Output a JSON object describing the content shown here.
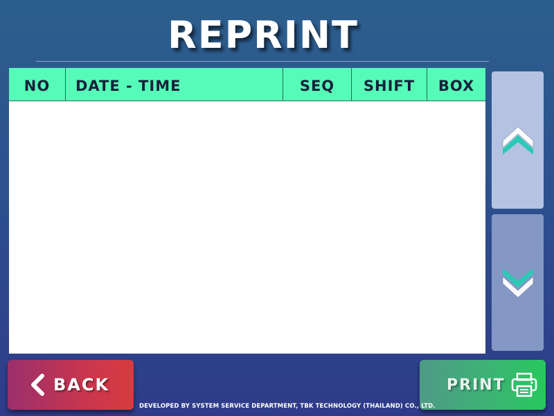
{
  "title": "REPRINT",
  "table": {
    "columns": [
      "NO",
      "DATE - TIME",
      "SEQ",
      "SHIFT",
      "BOX"
    ],
    "rows": []
  },
  "scroll": {
    "up_icon": "double-chevron-up-icon",
    "down_icon": "double-chevron-down-icon"
  },
  "buttons": {
    "back_label": "BACK",
    "back_icon": "chevron-left-icon",
    "print_label": "PRINT",
    "print_icon": "printer-icon"
  },
  "footer": {
    "credit": "DEVELOPED BY SYSTEM SERVICE DEPARTMENT, TBK TECHNOLOGY (THAILAND) CO., LTD."
  },
  "colors": {
    "header": "#56fbb7",
    "chevron": "#2cc9b6",
    "back": "#d83b3f",
    "print": "#27c85c"
  }
}
